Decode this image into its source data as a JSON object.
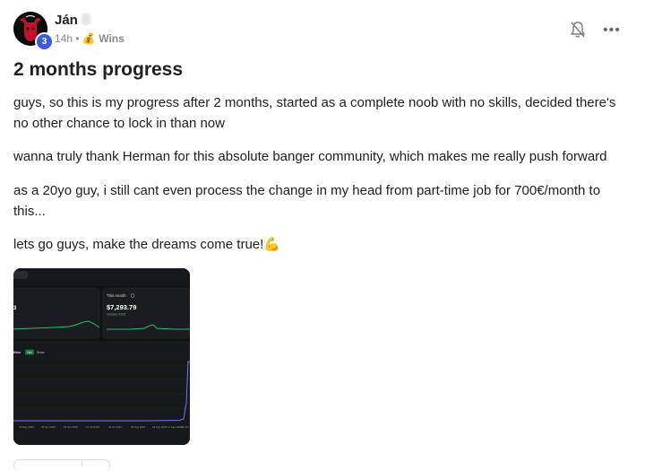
{
  "post": {
    "author": "Ján",
    "level": "3",
    "time": "14h",
    "separator": "•",
    "category_icon": "💰",
    "category": "Wins",
    "title": "2 months progress",
    "paragraphs": [
      "guys, so this is my progress after 2 months, started as a complete noob with no skills, decided there's no other chance to lock in than now",
      "wanna truly thank Herman for this absolute banger community, which makes me really push forward",
      "as a 20yo guy, i still cant even process the change in my head from part-time job for 700€/month to this...",
      "lets go guys, make the dreams come true!💪"
    ]
  },
  "actions": {
    "bell_icon": "bell-off-icon",
    "more_icon": "more-dots-icon",
    "more_label": "•••"
  },
  "attachment": {
    "card_label": "This month",
    "amount": "$7,293.79",
    "period": "October 2025",
    "chip_1": "Net",
    "chip_2": "Gross",
    "dates": [
      "23 May 2025",
      "08 Jun 2025",
      "24 Jun 2025",
      "10 Jul 2025",
      "26 Jul 2025",
      "08 Aug 2025",
      "26 Aug 2025",
      "11 Sep 2025",
      "08 Oct"
    ]
  },
  "colors": {
    "accent_green": "#22c55e",
    "level_badge": "#3b5bdb"
  }
}
